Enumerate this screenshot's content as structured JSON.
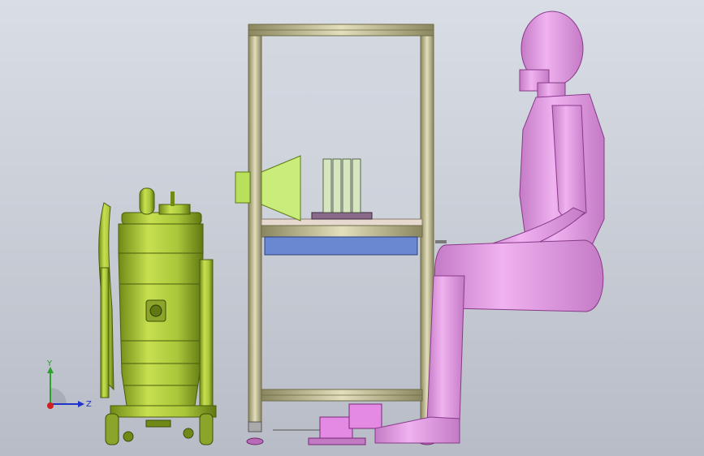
{
  "triad": {
    "y_label": "Y",
    "z_label": "Z",
    "colors": {
      "x": "#d02020",
      "y": "#2ea02e",
      "z": "#2233cc"
    }
  },
  "colors": {
    "vacuum": "#a9c63a",
    "vacuum_dark": "#6f8a16",
    "frame": "#c8c39a",
    "person": "#e59be6",
    "person_dark": "#a85aa8",
    "tray": "#6a87d2",
    "funnel": "#c9ec7a"
  }
}
